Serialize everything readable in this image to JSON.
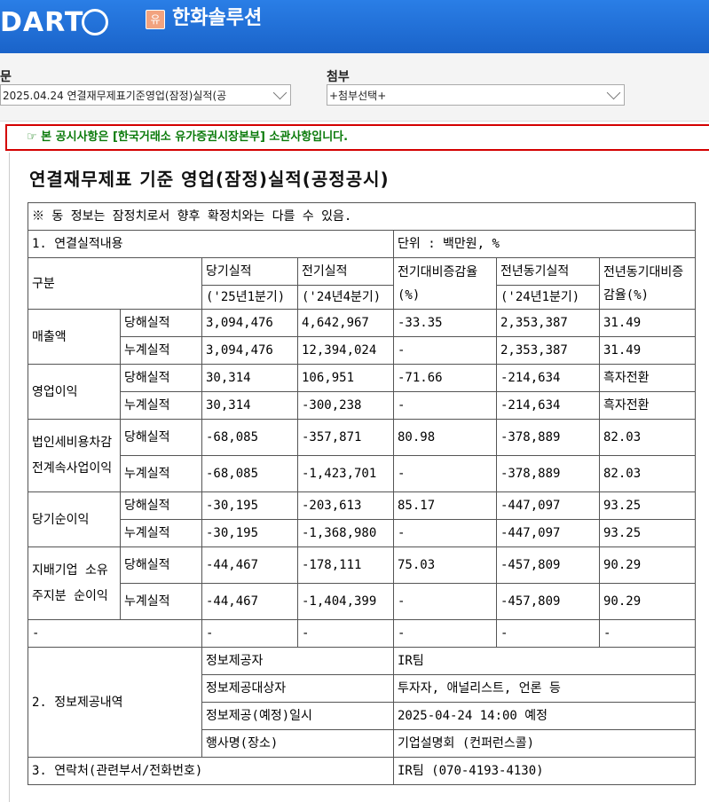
{
  "header": {
    "logo_text": "DART",
    "company_badge": "유",
    "company_name": "한화솔루션"
  },
  "selectors": {
    "report_label": "문",
    "report_value": "2025.04.24  연결재무제표기준영업(잠정)실적(공",
    "attach_label": "첨부",
    "attach_value": "+첨부선택+"
  },
  "notice": "☞ 본 공시사항은 [한국거래소 유가증권시장본부] 소관사항입니다.",
  "document": {
    "title": "연결재무제표 기준 영업(잠정)실적(공정공시)",
    "disclaimer": "※ 동 정보는 잠정치로서 향후 확정치와는 다를 수 있음.",
    "section1": "1. 연결실적내용",
    "unit": "단위 : 백만원, %",
    "headers": {
      "gubun": "구분",
      "current": "당기실적",
      "current_period": "('25년1분기)",
      "previous": "전기실적",
      "previous_period": "('24년4분기)",
      "qoq": "전기대비증감율(%)",
      "yoy_period_label": "전년동기실적",
      "yoy_period": "('24년1분기)",
      "yoy": "전년동기대비증감율(%)"
    },
    "rows": [
      {
        "item": "매출액",
        "sub": "당해실적",
        "current": "3,094,476",
        "previous": "4,642,967",
        "qoq": "-33.35",
        "yoy_value": "2,353,387",
        "yoy": "31.49"
      },
      {
        "item": "",
        "sub": "누계실적",
        "current": "3,094,476",
        "previous": "12,394,024",
        "qoq": "-",
        "yoy_value": "2,353,387",
        "yoy": "31.49"
      },
      {
        "item": "영업이익",
        "sub": "당해실적",
        "current": "30,314",
        "previous": "106,951",
        "qoq": "-71.66",
        "yoy_value": "-214,634",
        "yoy": "흑자전환"
      },
      {
        "item": "",
        "sub": "누계실적",
        "current": "30,314",
        "previous": "-300,238",
        "qoq": "-",
        "yoy_value": "-214,634",
        "yoy": "흑자전환"
      },
      {
        "item": "법인세비용차감전계속사업이익",
        "sub": "당해실적",
        "current": "-68,085",
        "previous": "-357,871",
        "qoq": "80.98",
        "yoy_value": "-378,889",
        "yoy": "82.03"
      },
      {
        "item": "",
        "sub": "누계실적",
        "current": "-68,085",
        "previous": "-1,423,701",
        "qoq": "-",
        "yoy_value": "-378,889",
        "yoy": "82.03"
      },
      {
        "item": "당기순이익",
        "sub": "당해실적",
        "current": "-30,195",
        "previous": "-203,613",
        "qoq": "85.17",
        "yoy_value": "-447,097",
        "yoy": "93.25"
      },
      {
        "item": "",
        "sub": "누계실적",
        "current": "-30,195",
        "previous": "-1,368,980",
        "qoq": "-",
        "yoy_value": "-447,097",
        "yoy": "93.25"
      },
      {
        "item": "지배기업 소유주지분 순이익",
        "sub": "당해실적",
        "current": "-44,467",
        "previous": "-178,111",
        "qoq": "75.03",
        "yoy_value": "-457,809",
        "yoy": "90.29"
      },
      {
        "item": "",
        "sub": "누계실적",
        "current": "-44,467",
        "previous": "-1,404,399",
        "qoq": "-",
        "yoy_value": "-457,809",
        "yoy": "90.29"
      }
    ],
    "dash_row": [
      "-",
      "-",
      "-",
      "-",
      "-",
      "-"
    ],
    "section2": {
      "label": "2. 정보제공내역",
      "provider_label": "정보제공자",
      "provider": "IR팀",
      "target_label": "정보제공대상자",
      "target": "투자자, 애널리스트, 언론 등",
      "date_label": "정보제공(예정)일시",
      "date": "2025-04-24 14:00 예정",
      "event_label": "행사명(장소)",
      "event": "기업설명회 (컨퍼런스콜)"
    },
    "section3": {
      "label": "3. 연락처(관련부서/전화번호)",
      "value": "IR팀 (070-4193-4130)"
    }
  }
}
